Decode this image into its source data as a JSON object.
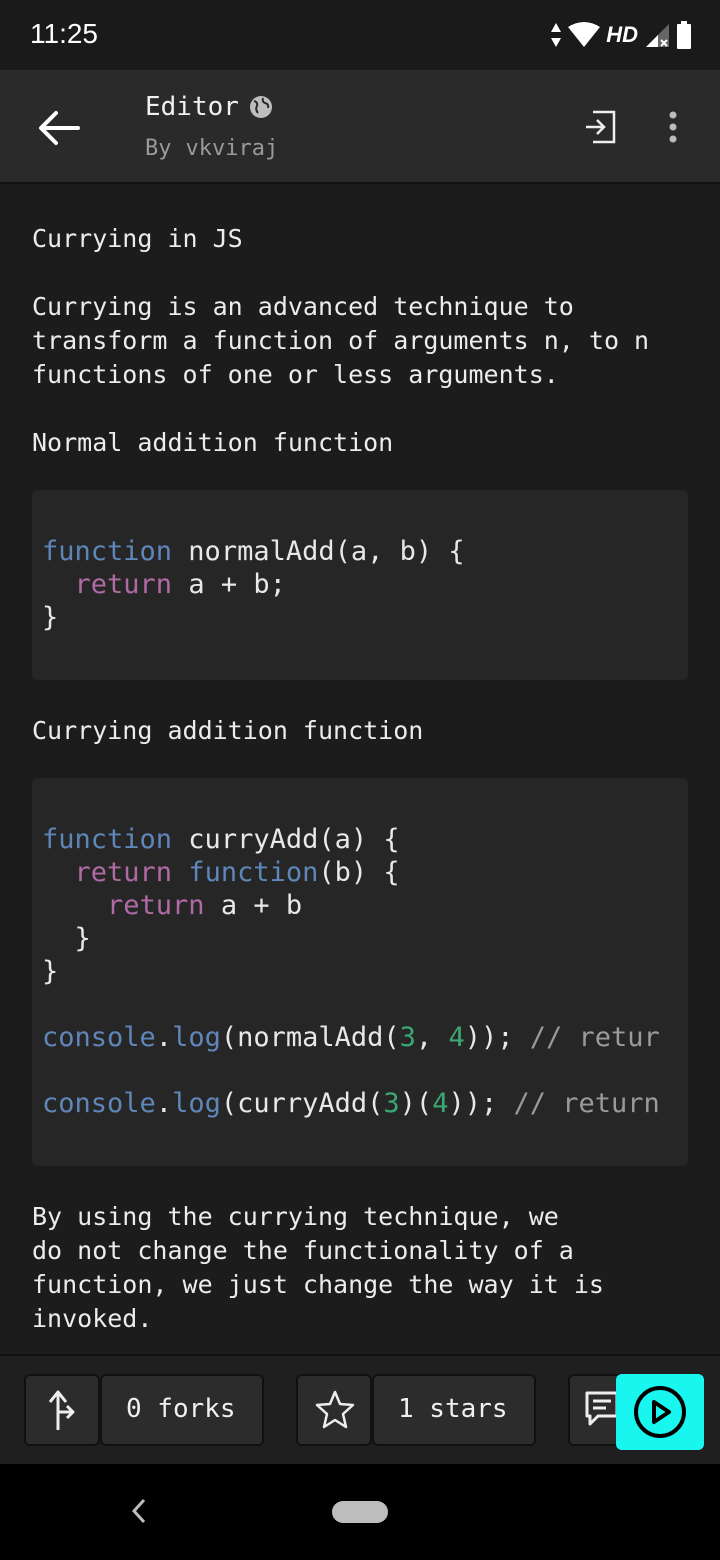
{
  "status_bar": {
    "time": "11:25",
    "network_label": "HD",
    "icons": [
      "data-arrows-icon",
      "wifi-icon",
      "signal-icon",
      "battery-icon"
    ]
  },
  "app_bar": {
    "title": "Editor",
    "by_label": "By",
    "author": "vkviraj",
    "icons": [
      "back-arrow-icon",
      "globe-icon",
      "exit-icon",
      "more-vert-icon"
    ]
  },
  "content": {
    "heading": "Currying in JS",
    "intro_lines": [
      "Currying is an advanced technique to",
      "transform a function of arguments n, to n",
      "functions of one or less arguments."
    ],
    "normal_label": "Normal addition function",
    "currying_label": "Currying addition function",
    "outro_lines": [
      "By using the currying technique, we",
      "do not change the functionality of a",
      "function, we just change the way it is",
      "invoked."
    ]
  },
  "code": {
    "normal": {
      "line1_kw": "function",
      "line1_rest": " normalAdd(a, b) {",
      "line2_indent": "  ",
      "line2_kw": "return",
      "line2_rest": " a + b;",
      "line3": "}"
    },
    "curry": {
      "l1_kw": "function",
      "l1_rest": " curryAdd(a) {",
      "l2_indent": "  ",
      "l2_kw": "return",
      "l2_kw2": " function",
      "l2_rest": "(b) {",
      "l3_indent": "    ",
      "l3_kw": "return",
      "l3_rest": " a + b",
      "l4": "  }",
      "l5": "}",
      "l6_obj": "console",
      "l6_dot": ".",
      "l6_method": "log",
      "l6_a": "(normalAdd(",
      "l6_n1": "3",
      "l6_b": ", ",
      "l6_n2": "4",
      "l6_c": ")); ",
      "l6_cmt": "// retur",
      "l7_obj": "console",
      "l7_dot": ".",
      "l7_method": "log",
      "l7_a": "(curryAdd(",
      "l7_n1": "3",
      "l7_b": ")(",
      "l7_n2": "4",
      "l7_c": ")); ",
      "l7_cmt": "// return"
    }
  },
  "action_bar": {
    "forks_label": "0 forks",
    "stars_label": "1 stars",
    "icons": [
      "fork-icon",
      "star-icon",
      "comment-icon",
      "play-icon"
    ],
    "run_color": "#19f5ef"
  }
}
